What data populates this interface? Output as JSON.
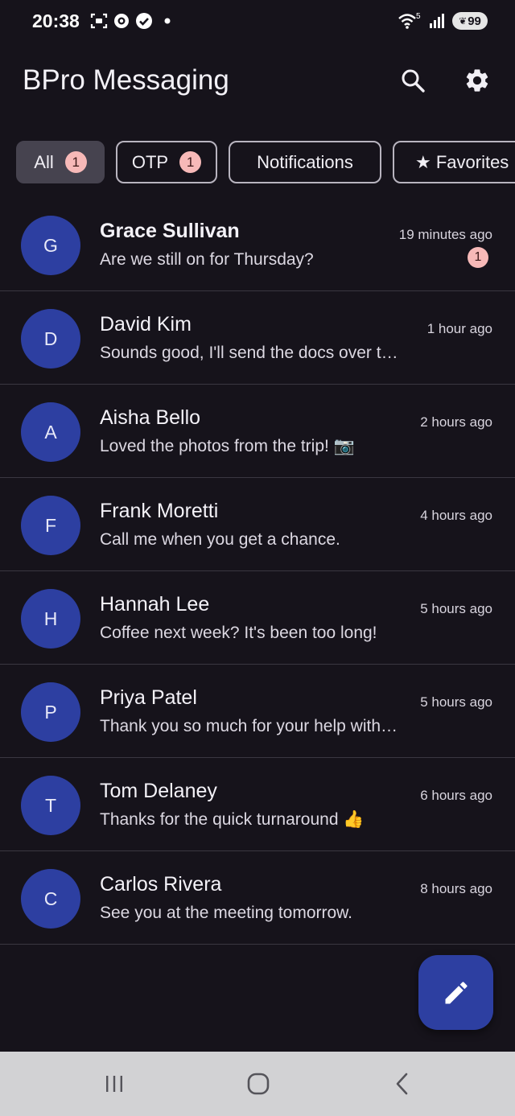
{
  "status_bar": {
    "time": "20:38",
    "network": "5",
    "battery": "99",
    "icons": [
      "screenshot-icon",
      "record-icon",
      "check-circle-icon",
      "dot-icon",
      "wifi-icon",
      "signal-icon",
      "battery-icon"
    ]
  },
  "app_bar": {
    "title": "BPro Messaging",
    "search_icon": "search-icon",
    "settings_icon": "gear-icon"
  },
  "filters": [
    {
      "label": "All",
      "badge": "1",
      "selected": true
    },
    {
      "label": "OTP",
      "badge": "1",
      "selected": false
    },
    {
      "label": "Notifications",
      "selected": false
    },
    {
      "label": "★ Favorites",
      "selected": false
    }
  ],
  "conversations": [
    {
      "initial": "G",
      "name": "Grace Sullivan",
      "preview": "Are we still on for Thursday?",
      "time": "19 minutes ago",
      "unread": "1"
    },
    {
      "initial": "D",
      "name": "David Kim",
      "preview": "Sounds good, I'll send the docs over tonight",
      "time": "1 hour ago"
    },
    {
      "initial": "A",
      "name": "Aisha Bello",
      "preview": "Loved the photos from the trip! 📷",
      "time": "2 hours ago"
    },
    {
      "initial": "F",
      "name": "Frank Moretti",
      "preview": "Call me when you get a chance.",
      "time": "4 hours ago"
    },
    {
      "initial": "H",
      "name": "Hannah Lee",
      "preview": "Coffee next week? It's been too long!",
      "time": "5 hours ago"
    },
    {
      "initial": "P",
      "name": "Priya Patel",
      "preview": "Thank you so much for your help with this",
      "time": "5 hours ago"
    },
    {
      "initial": "T",
      "name": "Tom Delaney",
      "preview": "Thanks for the quick turnaround 👍",
      "time": "6 hours ago"
    },
    {
      "initial": "C",
      "name": "Carlos Rivera",
      "preview": "See you at the meeting tomorrow.",
      "time": "8 hours ago"
    }
  ],
  "fab_icon": "edit-pencil-icon",
  "nav_bar": {
    "recents_icon": "recents-icon",
    "home_icon": "home-icon",
    "back_icon": "back-icon"
  },
  "colors": {
    "background": "#16131b",
    "accent": "#2d3fa1",
    "badge": "#f7b9b8",
    "nav_bar": "#d2d2d4"
  }
}
